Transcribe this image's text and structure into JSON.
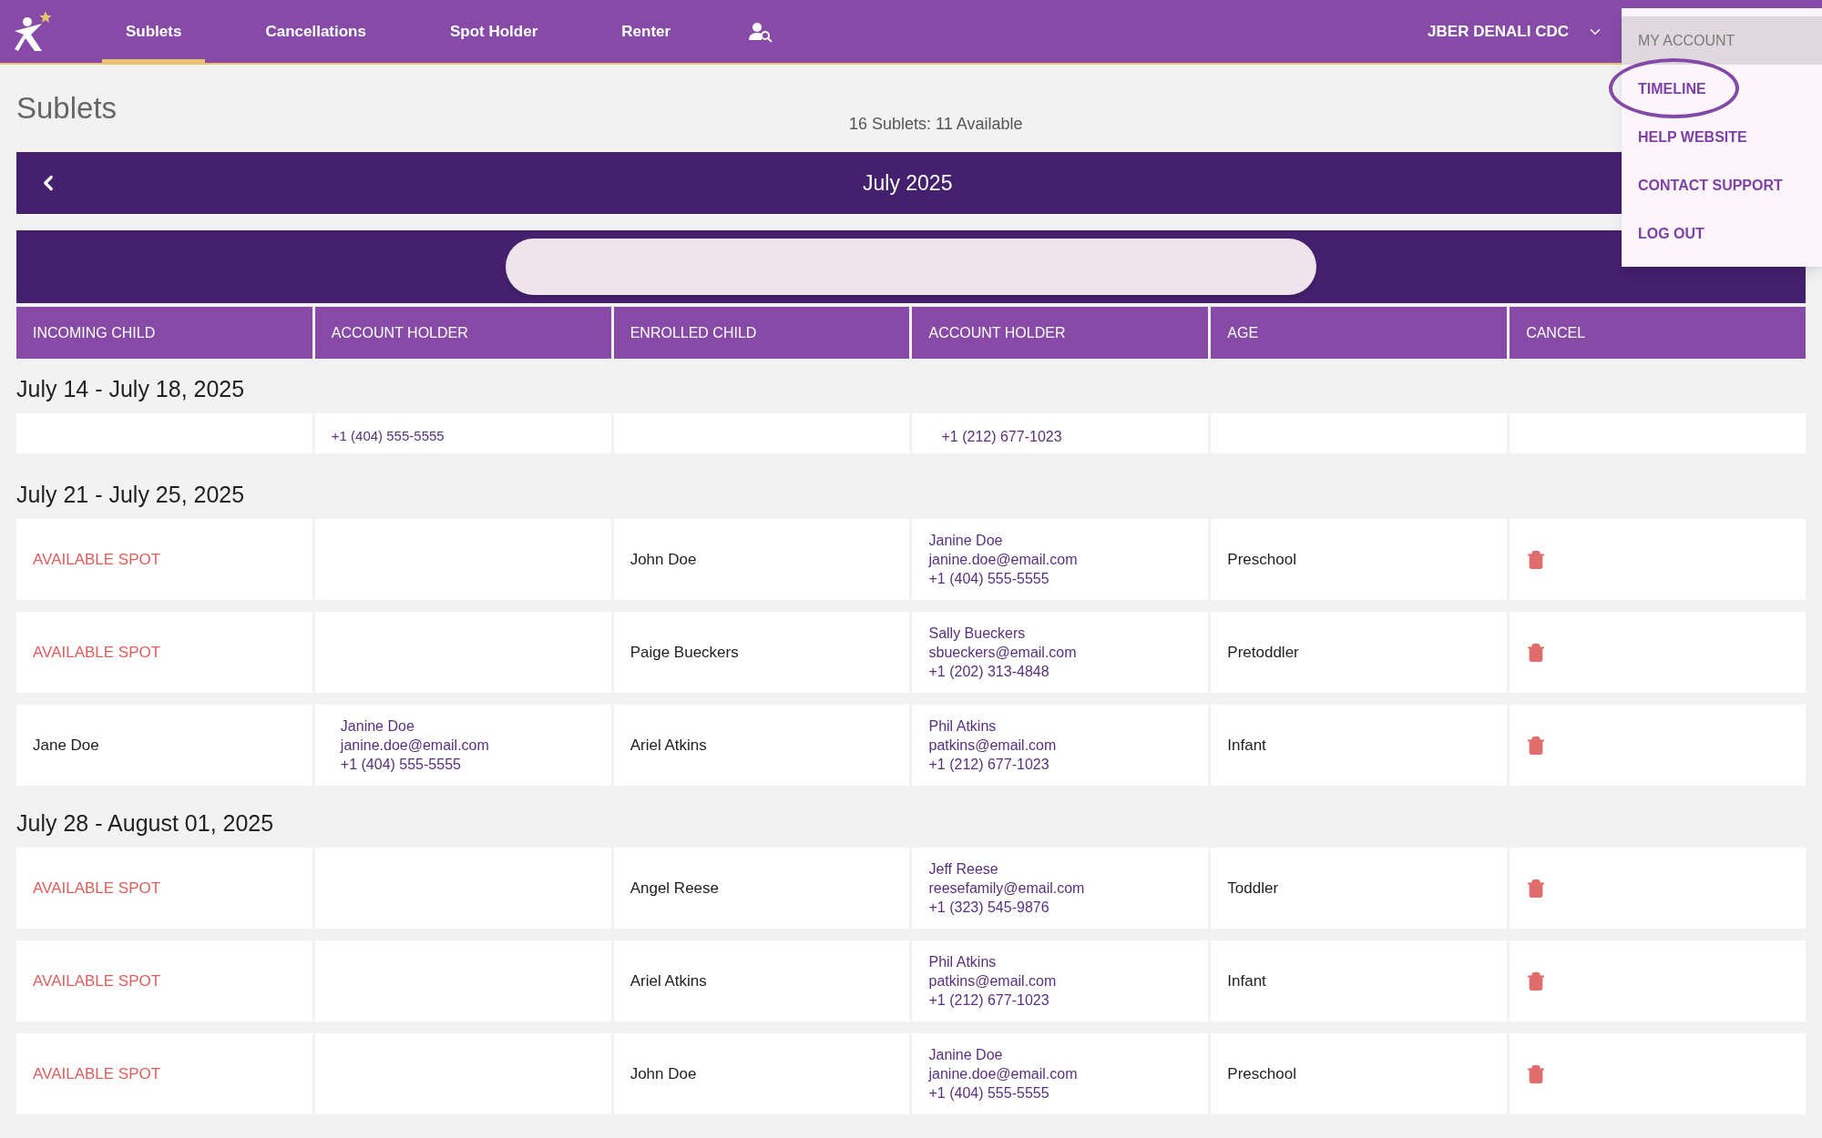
{
  "nav": {
    "tabs": [
      {
        "label": "Sublets",
        "selected": true
      },
      {
        "label": "Cancellations",
        "selected": false
      },
      {
        "label": "Spot Holder",
        "selected": false
      },
      {
        "label": "Renter",
        "selected": false
      }
    ],
    "account": "JBER DENALI CDC"
  },
  "menu": {
    "header": "MY ACCOUNT",
    "items": [
      {
        "label": "TIMELINE",
        "circled": true
      },
      {
        "label": "HELP WEBSITE",
        "circled": false
      },
      {
        "label": "CONTACT SUPPORT",
        "circled": false
      },
      {
        "label": "LOG OUT",
        "circled": false
      }
    ]
  },
  "page": {
    "title": "Sublets",
    "summary": "16 Sublets: 11 Available",
    "month": "July 2025"
  },
  "table": {
    "columns": [
      "INCOMING CHILD",
      "ACCOUNT HOLDER",
      "ENROLLED CHILD",
      "ACCOUNT HOLDER",
      "AGE",
      "CANCEL"
    ],
    "weeks": [
      {
        "label": "July 14 - July 18, 2025",
        "partial": true,
        "rows": [
          {
            "holder_phone": "+1 (404) 555-5555",
            "enrolled_phone": "+1 (212) 677-1023"
          }
        ]
      },
      {
        "label": "July 21 - July 25, 2025",
        "partial": false,
        "rows": [
          {
            "incoming": "AVAILABLE SPOT",
            "available": true,
            "enrolled": "John Doe",
            "enrolled_holder": [
              "Janine Doe",
              "janine.doe@email.com",
              "+1 (404) 555-5555"
            ],
            "age": "Preschool"
          },
          {
            "incoming": "AVAILABLE SPOT",
            "available": true,
            "enrolled": "Paige Bueckers",
            "enrolled_holder": [
              "Sally Bueckers",
              "sbueckers@email.com",
              "+1 (202) 313-4848"
            ],
            "age": "Pretoddler"
          },
          {
            "incoming": "Jane Doe",
            "available": false,
            "holder": [
              "Janine Doe",
              "janine.doe@email.com",
              "+1 (404) 555-5555"
            ],
            "enrolled": "Ariel Atkins",
            "enrolled_holder": [
              "Phil Atkins",
              "patkins@email.com",
              "+1 (212) 677-1023"
            ],
            "age": "Infant"
          }
        ]
      },
      {
        "label": "July 28 - August 01, 2025",
        "partial": false,
        "rows": [
          {
            "incoming": "AVAILABLE SPOT",
            "available": true,
            "enrolled": "Angel Reese",
            "enrolled_holder": [
              "Jeff Reese",
              "reesefamily@email.com",
              "+1 (323) 545-9876"
            ],
            "age": "Toddler"
          },
          {
            "incoming": "AVAILABLE SPOT",
            "available": true,
            "enrolled": "Ariel Atkins",
            "enrolled_holder": [
              "Phil Atkins",
              "patkins@email.com",
              "+1 (212) 677-1023"
            ],
            "age": "Infant"
          },
          {
            "incoming": "AVAILABLE SPOT",
            "available": true,
            "enrolled": "John Doe",
            "enrolled_holder": [
              "Janine Doe",
              "janine.doe@email.com",
              "+1 (404) 555-5555"
            ],
            "age": "Preschool"
          }
        ]
      }
    ]
  }
}
